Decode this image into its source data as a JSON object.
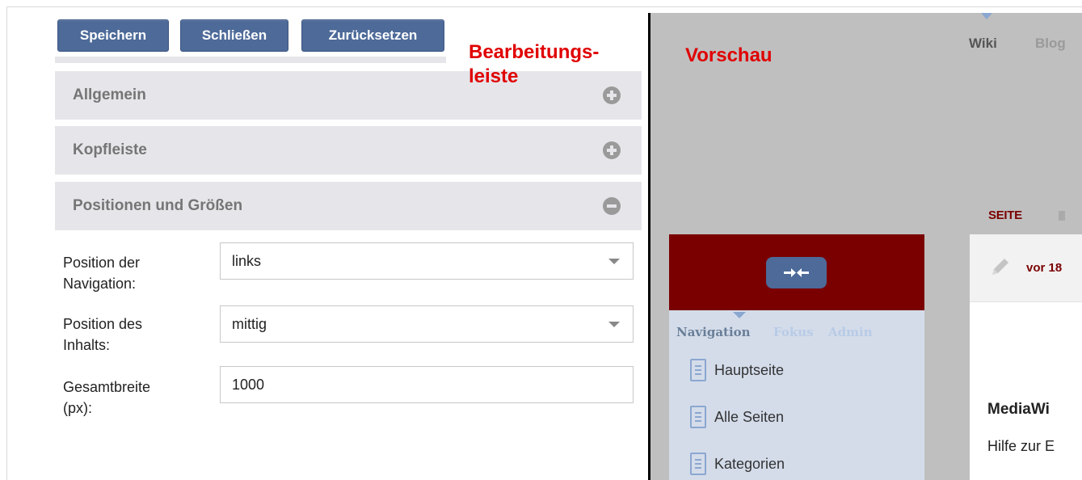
{
  "toolbar": {
    "save_label": "Speichern",
    "close_label": "Schließen",
    "reset_label": "Zurücksetzen"
  },
  "annotations": {
    "editor_line1": "Bearbeitungs-",
    "editor_line2": "leiste",
    "preview": "Vorschau"
  },
  "sections": [
    {
      "label": "Allgemein",
      "state": "collapsed",
      "icon": "plus-circle-icon"
    },
    {
      "label": "Kopfleiste",
      "state": "collapsed",
      "icon": "plus-circle-icon"
    },
    {
      "label": "Positionen und Größen",
      "state": "expanded",
      "icon": "minus-circle-icon"
    }
  ],
  "form": {
    "nav_position": {
      "label_line1": "Position der",
      "label_line2": "Navigation:",
      "value": "links"
    },
    "content_position": {
      "label_line1": "Position des",
      "label_line2": "Inhalts:",
      "value": "mittig"
    },
    "total_width": {
      "label_line1": "Gesamtbreite",
      "label_line2": "(px):",
      "value": "1000"
    }
  },
  "preview": {
    "top_tabs": {
      "wiki": "Wiki",
      "blog": "Blog"
    },
    "page_tab": "SEITE",
    "nav_tabs": {
      "navigation": "Navigation",
      "fokus": "Fokus",
      "admin": "Admin"
    },
    "nav_items": [
      "Hauptseite",
      "Alle Seiten",
      "Kategorien"
    ],
    "content": {
      "edited_ago": "vor 18",
      "title": "MediaWi",
      "help": "Hilfe zur E"
    }
  },
  "colors": {
    "button_bg": "#4d6a99",
    "section_bg": "#e6e6ea",
    "annotation_red": "#e00000",
    "skin_dark_red": "#7a0000",
    "nav_bg": "#d4dcea",
    "preview_bg": "#bfbfbf"
  }
}
